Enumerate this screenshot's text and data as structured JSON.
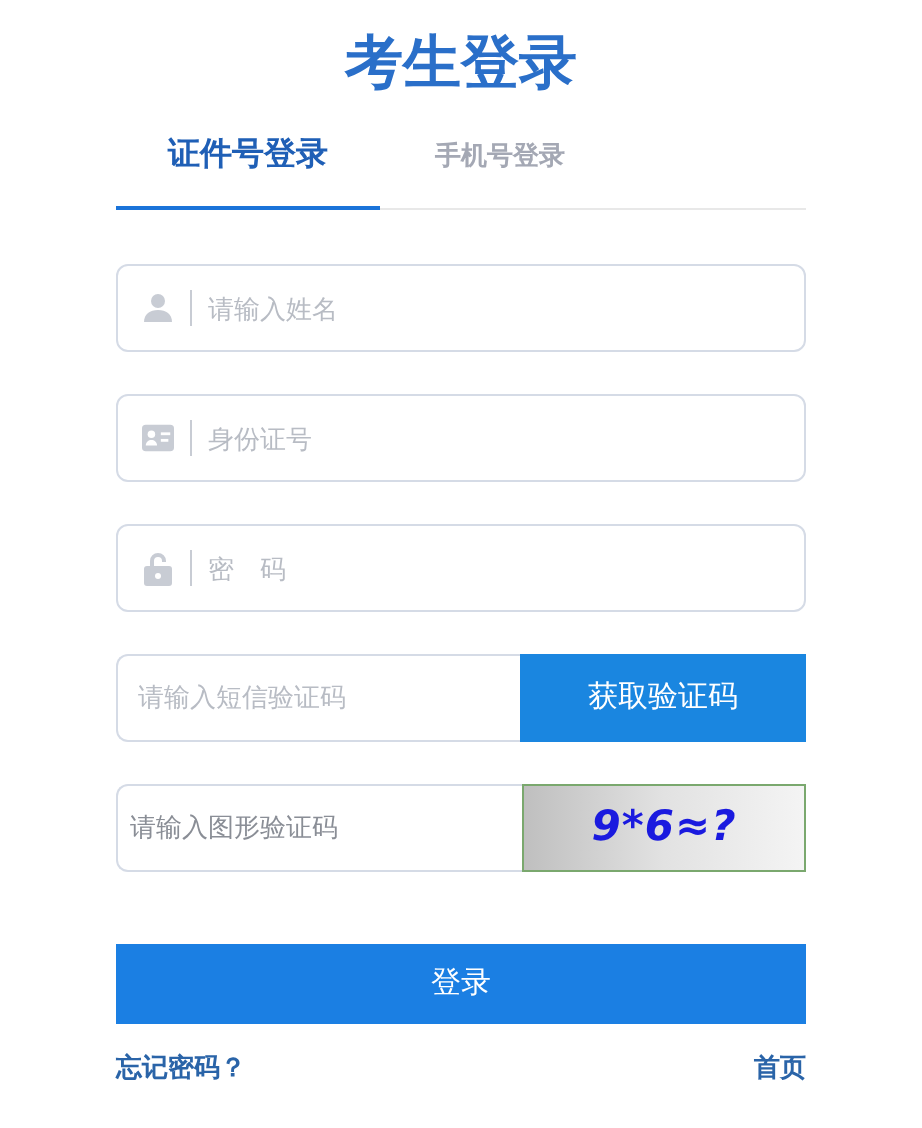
{
  "title": "考生登录",
  "tabs": [
    {
      "label": "证件号登录",
      "selected": true
    },
    {
      "label": "手机号登录",
      "selected": false
    }
  ],
  "fields": [
    {
      "kind": "name",
      "placeholder": "请输入姓名"
    },
    {
      "kind": "idcard",
      "placeholder": "身份证号"
    },
    {
      "kind": "password",
      "placeholder": "密　码"
    },
    {
      "kind": "sms",
      "placeholder": "请输入短信验证码",
      "button": "获取验证码"
    },
    {
      "kind": "captcha",
      "placeholder": "请输入图形验证码",
      "captcha_text": "9*6≈?"
    }
  ],
  "submit": "登录",
  "links": [
    "忘记密码？",
    "首页"
  ]
}
